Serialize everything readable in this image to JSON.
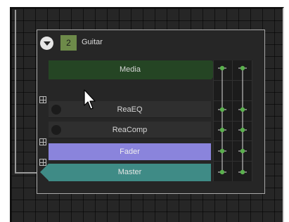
{
  "track": {
    "number": "2",
    "name": "Guitar"
  },
  "rows": {
    "media": "Media",
    "fx1": "ReaEQ",
    "fx2": "ReaComp",
    "fader": "Fader",
    "master": "Master"
  },
  "colors": {
    "media": "#254524",
    "fader": "#8a84dc",
    "master": "#3f8b86",
    "track_number_bg": "#6d8a49",
    "pin_node": "#5bb04e"
  },
  "icons": {
    "collapse": "chevron-down-icon",
    "add": "plus-box-icon",
    "cursor": "mouse-pointer-icon"
  }
}
